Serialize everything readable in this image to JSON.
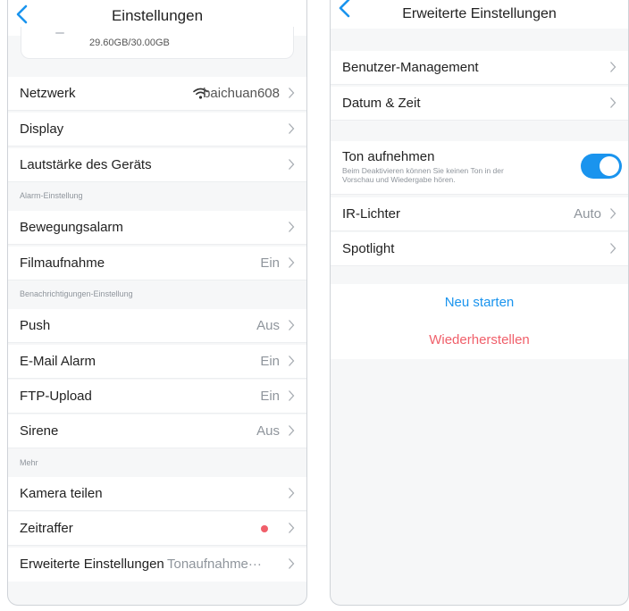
{
  "left_screen": {
    "title": "Einstellungen",
    "storage": "29.60GB/30.00GB",
    "rows": [
      {
        "label": "Netzwerk",
        "value": "baichuan608"
      },
      {
        "label": "Display",
        "value": ""
      },
      {
        "label": "Lautstärke des Geräts",
        "value": ""
      },
      {
        "label": "Bewegungsalarm",
        "value": ""
      },
      {
        "label": "Filmaufnahme",
        "value": "Ein"
      },
      {
        "label": "Push",
        "value": "Aus"
      },
      {
        "label": "E-Mail Alarm",
        "value": "Ein"
      },
      {
        "label": "FTP-Upload",
        "value": "Ein"
      },
      {
        "label": "Sirene",
        "value": "Aus"
      },
      {
        "label": "Kamera teilen",
        "value": ""
      },
      {
        "label": "Zeitraffer",
        "value": ""
      },
      {
        "label": "Erweiterte Einstellungen",
        "value": "Tonaufnahme···"
      }
    ],
    "sections": {
      "alarm": "Alarm-Einstellung",
      "notify": "Benachrichtigungen-Einstellung",
      "more": "Mehr"
    }
  },
  "right_screen": {
    "title": "Erweiterte Einstellungen",
    "rows": [
      {
        "label": "Benutzer-Management",
        "value": ""
      },
      {
        "label": "Datum & Zeit",
        "value": ""
      },
      {
        "label": "IR-Lichter",
        "value": "Auto"
      },
      {
        "label": "Spotlight",
        "value": ""
      }
    ],
    "record_audio": {
      "label": "Ton aufnehmen",
      "description_line1": "Beim Deaktivieren können Sie keinen Ton in der",
      "description_line2": "Vorschau und Wiedergabe hören.",
      "enabled": true
    },
    "restart_label": "Neu starten",
    "restore_label": "Wiederherstellen"
  },
  "colors": {
    "accent": "#1a94ee",
    "danger": "#f05f6a",
    "muted": "#8f959c"
  },
  "icons": [
    "back-icon",
    "wifi-icon",
    "chevron-right-icon",
    "status-dot-icon"
  ]
}
